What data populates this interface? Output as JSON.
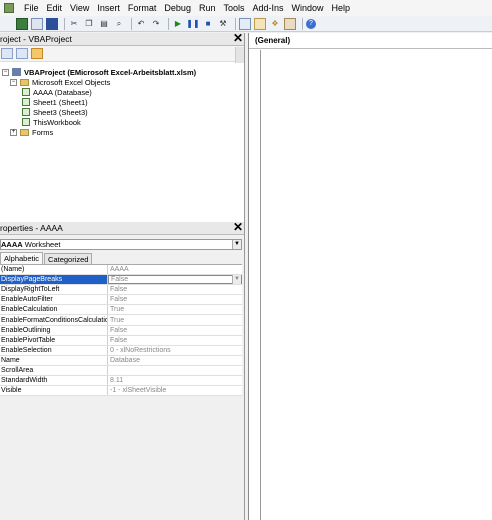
{
  "menu": [
    "File",
    "Edit",
    "View",
    "Insert",
    "Format",
    "Debug",
    "Run",
    "Tools",
    "Add-Ins",
    "Window",
    "Help"
  ],
  "project": {
    "title": "roject - VBAProject",
    "root": "VBAProject (EMicrosoft Excel-Arbeitsblatt.xlsm)",
    "objects_folder": "Microsoft Excel Objects",
    "items": [
      "AAAA (Database)",
      "Sheet1 (Sheet1)",
      "Sheet3 (Sheet3)",
      "ThisWorkbook"
    ],
    "forms_folder": "Forms"
  },
  "properties": {
    "title": "roperties - AAAA",
    "object": "AAAA",
    "object_type": "Worksheet",
    "tabs": [
      "Alphabetic",
      "Categorized"
    ],
    "rows": [
      {
        "name": "(Name)",
        "value": "AAAA"
      },
      {
        "name": "DisplayPageBreaks",
        "value": "False"
      },
      {
        "name": "DisplayRightToLeft",
        "value": "False"
      },
      {
        "name": "EnableAutoFilter",
        "value": "False"
      },
      {
        "name": "EnableCalculation",
        "value": "True"
      },
      {
        "name": "EnableFormatConditionsCalculation",
        "value": "True"
      },
      {
        "name": "EnableOutlining",
        "value": "False"
      },
      {
        "name": "EnablePivotTable",
        "value": "False"
      },
      {
        "name": "EnableSelection",
        "value": "0 - xlNoRestrictions"
      },
      {
        "name": "Name",
        "value": "Database"
      },
      {
        "name": "ScrollArea",
        "value": ""
      },
      {
        "name": "StandardWidth",
        "value": "8.11"
      },
      {
        "name": "Visible",
        "value": "-1 - xlSheetVisible"
      }
    ],
    "selected_row": 1
  },
  "code": {
    "object_combo": "(General)"
  },
  "colors": {
    "selection": "#1e5fc8",
    "toolbar_bg": "#eef1f6"
  }
}
